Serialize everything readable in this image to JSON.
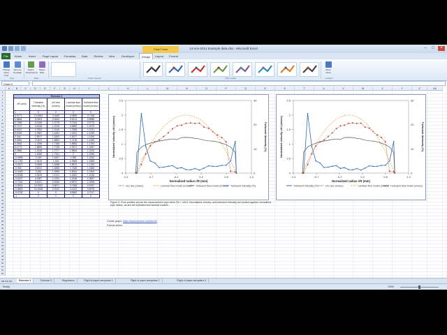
{
  "window": {
    "title": "14-nov-2014 Example data.xlsx - Microsoft Excel",
    "context_tab": "Chart Tools"
  },
  "tabs": [
    "File",
    "Home",
    "Insert",
    "Page Layout",
    "Formulas",
    "Data",
    "Review",
    "View",
    "Developer",
    "Design",
    "Layout",
    "Format"
  ],
  "ribbon": {
    "buttons": [
      "Change Chart Type",
      "Save As Template",
      "Switch Row/Column",
      "Select Data",
      "Move Chart"
    ],
    "groups": [
      "Type",
      "Data",
      "Chart Layouts",
      "Chart Styles",
      "Location"
    ]
  },
  "namebox": "Chart 2",
  "columns": [
    "A",
    "B",
    "C",
    "D",
    "E",
    "F",
    "G",
    "H",
    "I",
    "J",
    "K",
    "L",
    "M",
    "N",
    "O",
    "P",
    "Q",
    "R",
    "S",
    "T",
    "U",
    "V",
    "W",
    "X",
    "Y",
    "Z",
    "AA",
    "AB"
  ],
  "rows": [
    "1",
    "2",
    "3",
    "4",
    "5",
    "6",
    "7",
    "8",
    "9",
    "10",
    "11",
    "12",
    "13",
    "14",
    "15",
    "16",
    "17",
    "18",
    "19",
    "20",
    "21",
    "22",
    "23",
    "24",
    "25",
    "26",
    "27",
    "28",
    "29",
    "30",
    "31",
    "32",
    "33",
    "34",
    "35",
    "36",
    "37",
    "38",
    "39",
    "40",
    "41",
    "42",
    "43",
    "44",
    "45",
    "46",
    "47",
    "48",
    "49",
    "50",
    "51",
    "52",
    "53"
  ],
  "table": {
    "title": "Exercise 2",
    "headers": [
      "r/R (mm)",
      "Turbulent intensity (%)",
      "u/U ave (m/sec)",
      "Laminar flow model (m/sec)",
      "Turbulent flow model (m/sec)"
    ],
    "rows": [
      [
        "1",
        "0",
        "0",
        "0",
        "0"
      ],
      [
        "0.9773",
        "13.0553",
        "0.0445",
        "0.0896",
        "0.7158"
      ],
      [
        "0.8864",
        "5.0303",
        "0.0634",
        "0.4213",
        "0.8988"
      ],
      [
        "0.7955",
        "3.2166",
        "1.0778",
        "0.7344",
        "0.9773"
      ],
      [
        "0.7107",
        "3.1818",
        "1.2216",
        "0.9899",
        "1.0279"
      ],
      [
        "0.6210",
        "2.7834",
        "1.3145",
        "1.2358",
        "1.0741"
      ],
      [
        "0.5329",
        "2.7887",
        "1.4261",
        "1.4311",
        "1.1029"
      ],
      [
        "0.446",
        "2.9917",
        "1.5453",
        "1.6017",
        "1.1106"
      ],
      [
        "0.3551",
        "2.0422",
        "1.5853",
        "1.7478",
        "1.1349"
      ],
      [
        "0.2662",
        "1.2258",
        "1.7185",
        "1.8583",
        "1.1764"
      ],
      [
        "0.1773",
        "1.8895",
        "1.7135",
        "1.9371",
        "1.1957"
      ],
      [
        "0.0884",
        "1.3318",
        "1.7277",
        "1.9844",
        "1.2234"
      ],
      [
        "0",
        "1.4355",
        "1.7161",
        "2",
        "1.2295"
      ],
      [
        "-0.0895",
        "2.245",
        "1.6497",
        "1.984",
        "1.2232"
      ],
      [
        "-0.1782",
        "1.9419",
        "1.626",
        "1.9365",
        "1.1565"
      ],
      [
        "-0.2671",
        "3.0656",
        "1.5288",
        "1.8573",
        "1.1762"
      ],
      [
        "-0.356",
        "2.8331",
        "1.3856",
        "1.7465",
        "1.1568"
      ],
      [
        "-0.4449",
        "2.454",
        "1.2593",
        "1.6041",
        "1.1304"
      ],
      [
        "-0.5338",
        "2.2815",
        "1.1411",
        "1.4302",
        "1.1026"
      ],
      [
        "-0.6227",
        "4.1987",
        "1.0751",
        "1.2246",
        "1.0697"
      ],
      [
        "-0.7116",
        "5.0021",
        "0.9349",
        "0.9874",
        "1.0295"
      ],
      [
        "-0.8004",
        "10.9152",
        "0.6571",
        "0.7186",
        "0.9767"
      ],
      [
        "-0.8893",
        "24.6168",
        "0.2942",
        "0.4102",
        "0.8978"
      ],
      [
        "-0.9782",
        "0",
        "0",
        "0.0862",
        "0.7217"
      ],
      [
        "-1",
        "0",
        "0",
        "0",
        "0"
      ]
    ]
  },
  "chart_data": [
    {
      "type": "line",
      "xlabel": "Normalized radius r/R (mm)",
      "ylabel": "Normalized velocity u/U (m/sec)",
      "y2label": "Turbulent intensity (%)",
      "xlim": [
        -1.2,
        1.3
      ],
      "xticks": [
        "-1.2",
        "-0.7",
        "-0.2",
        "0.3",
        "0.8",
        "1.3"
      ],
      "ylim": [
        0,
        2.5
      ],
      "yticks": [
        "0",
        "0.5",
        "1",
        "1.5",
        "2",
        "2.5"
      ],
      "y2lim": [
        0,
        30
      ],
      "y2ticks": [
        "0",
        "10",
        "20",
        "30"
      ],
      "legend_position": "bottom",
      "x": [
        1,
        0.9773,
        0.8864,
        0.7955,
        0.7107,
        0.621,
        0.5329,
        0.446,
        0.3551,
        0.2662,
        0.1773,
        0.0884,
        0,
        -0.0895,
        -0.1782,
        -0.2671,
        -0.356,
        -0.4449,
        -0.5338,
        -0.6227,
        -0.7116,
        -0.8004,
        -0.8893,
        -0.9782,
        -1
      ],
      "series": [
        {
          "name": "u/U ave (m/sec)",
          "color": "#c0392b",
          "style": "dots",
          "axis": "left",
          "values": [
            0,
            0.0445,
            0.0634,
            1.0778,
            1.2216,
            1.3145,
            1.4261,
            1.5453,
            1.5853,
            1.7185,
            1.7135,
            1.7277,
            1.7161,
            1.6497,
            1.626,
            1.5288,
            1.3856,
            1.2593,
            1.1411,
            1.0751,
            0.9349,
            0.6571,
            0.2942,
            0,
            0
          ]
        },
        {
          "name": "Laminar flow model (m/sec)",
          "color": "#e0a030",
          "style": "dashed",
          "axis": "left",
          "values": [
            0,
            0.0896,
            0.4213,
            0.7344,
            0.9899,
            1.2358,
            1.4311,
            1.6017,
            1.7478,
            1.8583,
            1.9371,
            1.9844,
            2,
            1.984,
            1.9365,
            1.8573,
            1.7465,
            1.6041,
            1.4302,
            1.2246,
            0.9874,
            0.7186,
            0.4102,
            0.0862,
            0
          ]
        },
        {
          "name": "Turbulent flow model (m/sec)",
          "color": "#555555",
          "style": "solid",
          "axis": "left",
          "values": [
            0,
            0.7158,
            0.8988,
            0.9773,
            1.0279,
            1.0741,
            1.1029,
            1.1106,
            1.1349,
            1.1764,
            1.1957,
            1.2234,
            1.2295,
            1.2232,
            1.1565,
            1.1762,
            1.1568,
            1.1304,
            1.1026,
            1.0697,
            1.0295,
            0.9767,
            0.8978,
            0.7217,
            0
          ]
        },
        {
          "name": "Turbulent intensity (%)",
          "color": "#2e6db4",
          "style": "line-markers",
          "axis": "right",
          "values": [
            0,
            13.0553,
            5.0303,
            3.2166,
            3.1818,
            2.7834,
            2.7887,
            2.9917,
            2.0422,
            1.2258,
            1.8895,
            1.3318,
            1.4355,
            2.245,
            1.9419,
            3.0656,
            2.8331,
            2.454,
            2.2815,
            4.1987,
            5.0021,
            10.9152,
            24.6168,
            0,
            0
          ]
        }
      ]
    },
    {
      "type": "line",
      "xlabel": "Normalized radius r/R (mm)",
      "ylabel": "Normalized velocity u/U (m/sec)",
      "y2label": "Turbulent intensity (%)",
      "xlim": [
        -1.2,
        1.3
      ],
      "xticks": [
        "-1.2",
        "-0.7",
        "-0.2",
        "0.3",
        "0.8",
        "1.3"
      ],
      "ylim": [
        0,
        2.5
      ],
      "yticks": [
        "0",
        "0.5",
        "1",
        "1.5",
        "2",
        "2.5"
      ],
      "y2lim": [
        0,
        30
      ],
      "y2ticks": [
        "0",
        "10",
        "20",
        "30"
      ],
      "legend_position": "bottom",
      "series_ref": "same as chart 1"
    }
  ],
  "caption": "Figure 3. Flow profiles across the measurement pipe when Re = 1813. Normalized velocity, and turbulent intensity are plotted against normalized pipe radius, as are the turbulent and laminar models.",
  "notes": {
    "create_graph_label": "Create graph:",
    "create_graph_link": "https://www.screenr.com/ixcJN",
    "format_series": "Format series:"
  },
  "sheet_tabs": [
    "Exercise 2",
    "Exercise 3",
    "Regression",
    "Flight of paper aeroplane 1",
    "Flight of paper aeroplane 2",
    "Flight of paper aeroplane 3"
  ],
  "active_sheet": "Exercise 2",
  "status": {
    "left": "Ready",
    "zoom": "100%"
  }
}
